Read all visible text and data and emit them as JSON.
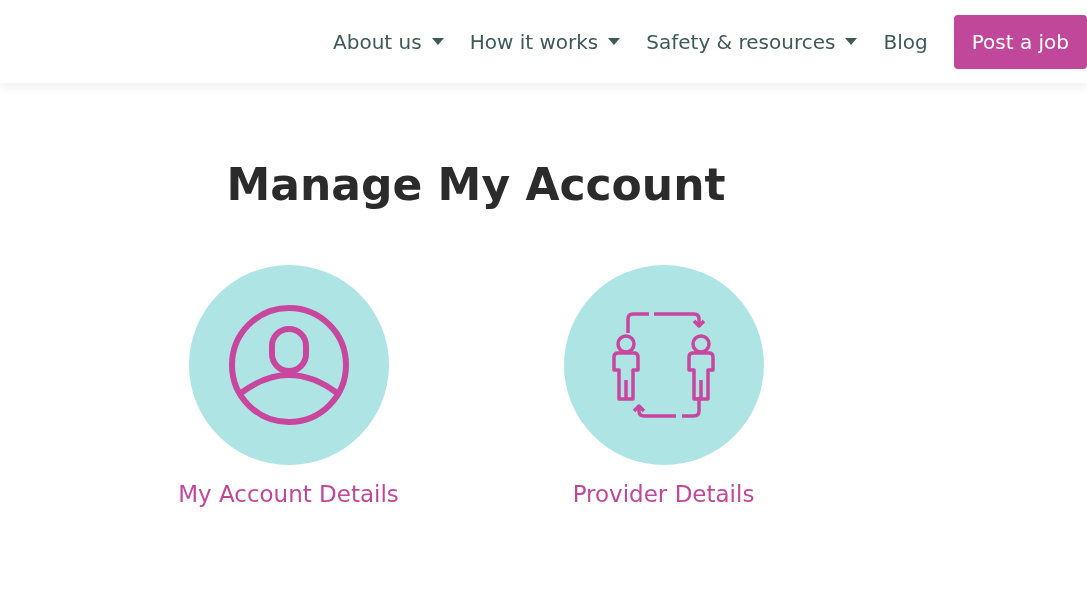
{
  "nav": {
    "items": [
      {
        "label": "About us",
        "has_menu": true
      },
      {
        "label": "How it works",
        "has_menu": true
      },
      {
        "label": "Safety & resources",
        "has_menu": true
      },
      {
        "label": "Blog",
        "has_menu": false
      }
    ],
    "cta": "Post a job"
  },
  "title": "Manage My Account",
  "cards": [
    {
      "label": "My Account Details",
      "kind": "person"
    },
    {
      "label": "Provider Details",
      "kind": "exchange"
    }
  ]
}
